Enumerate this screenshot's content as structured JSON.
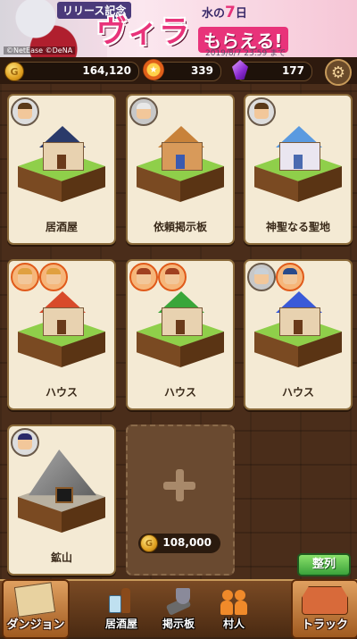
{
  "banner": {
    "release_label": "リリース記念",
    "title": "ヴィラ",
    "subtitle": "水の",
    "subtitle_number": "7",
    "subtitle_suffix": "日",
    "reward_text": "もらえる!",
    "deadline": "2019/8/7 23:59 まで",
    "copyright": "©NetEase ©DeNA"
  },
  "resources": {
    "gold": "164,120",
    "medals": "339",
    "gems": "177"
  },
  "buildings": [
    {
      "name": "居酒屋",
      "roof": "navy",
      "avatars": [
        "a1"
      ]
    },
    {
      "name": "依頼掲示板",
      "roof": "wood",
      "avatars": [
        "a7"
      ]
    },
    {
      "name": "神聖なる聖地",
      "roof": "sky",
      "avatars": [
        "a1"
      ]
    },
    {
      "name": "ハウス",
      "roof": "red",
      "avatars": [
        "a4",
        "a4"
      ]
    },
    {
      "name": "ハウス",
      "roof": "green",
      "avatars": [
        "a3",
        "a3"
      ]
    },
    {
      "name": "ハウス",
      "roof": "blue",
      "avatars": [
        "a7",
        "a6"
      ]
    },
    {
      "name": "鉱山",
      "roof": "mine",
      "avatars": [
        "a5"
      ]
    }
  ],
  "new_slot": {
    "cost": "108,000"
  },
  "sort_button": "整列",
  "nav": {
    "dungeon": "ダンジョン",
    "tavern": "居酒屋",
    "board": "掲示板",
    "villagers": "村人",
    "truck": "トラック"
  }
}
